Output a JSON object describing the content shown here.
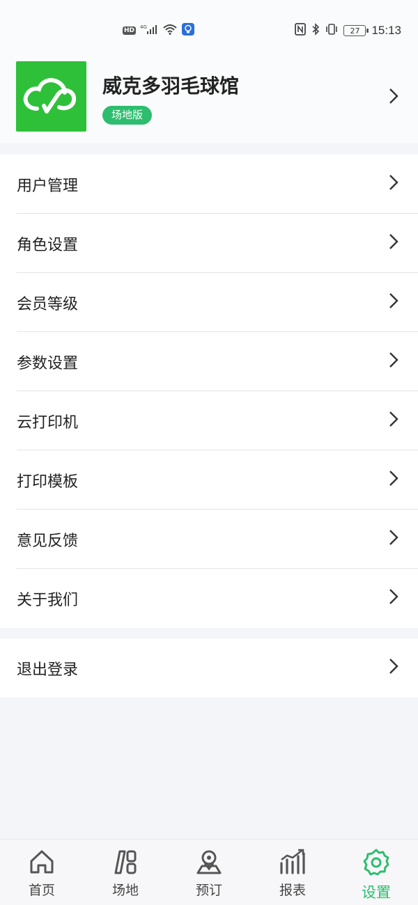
{
  "status_bar": {
    "hd": "HD",
    "network": "4G",
    "time": "15:13",
    "battery": "27"
  },
  "venue": {
    "name": "威克多羽毛球馆",
    "badge": "场地版",
    "logo_color": "#2fc03a",
    "badge_color": "#2dbd6e"
  },
  "menu": {
    "items": [
      {
        "label": "用户管理"
      },
      {
        "label": "角色设置"
      },
      {
        "label": "会员等级"
      },
      {
        "label": "参数设置"
      },
      {
        "label": "云打印机"
      },
      {
        "label": "打印模板"
      },
      {
        "label": "意见反馈"
      },
      {
        "label": "关于我们"
      }
    ],
    "logout": "退出登录"
  },
  "tabbar": {
    "active_color": "#2dbd6e",
    "tabs": [
      {
        "label": "首页",
        "icon": "home-icon"
      },
      {
        "label": "场地",
        "icon": "court-icon"
      },
      {
        "label": "预订",
        "icon": "booking-icon"
      },
      {
        "label": "报表",
        "icon": "report-icon"
      },
      {
        "label": "设置",
        "icon": "gear-icon",
        "active": true
      }
    ]
  }
}
